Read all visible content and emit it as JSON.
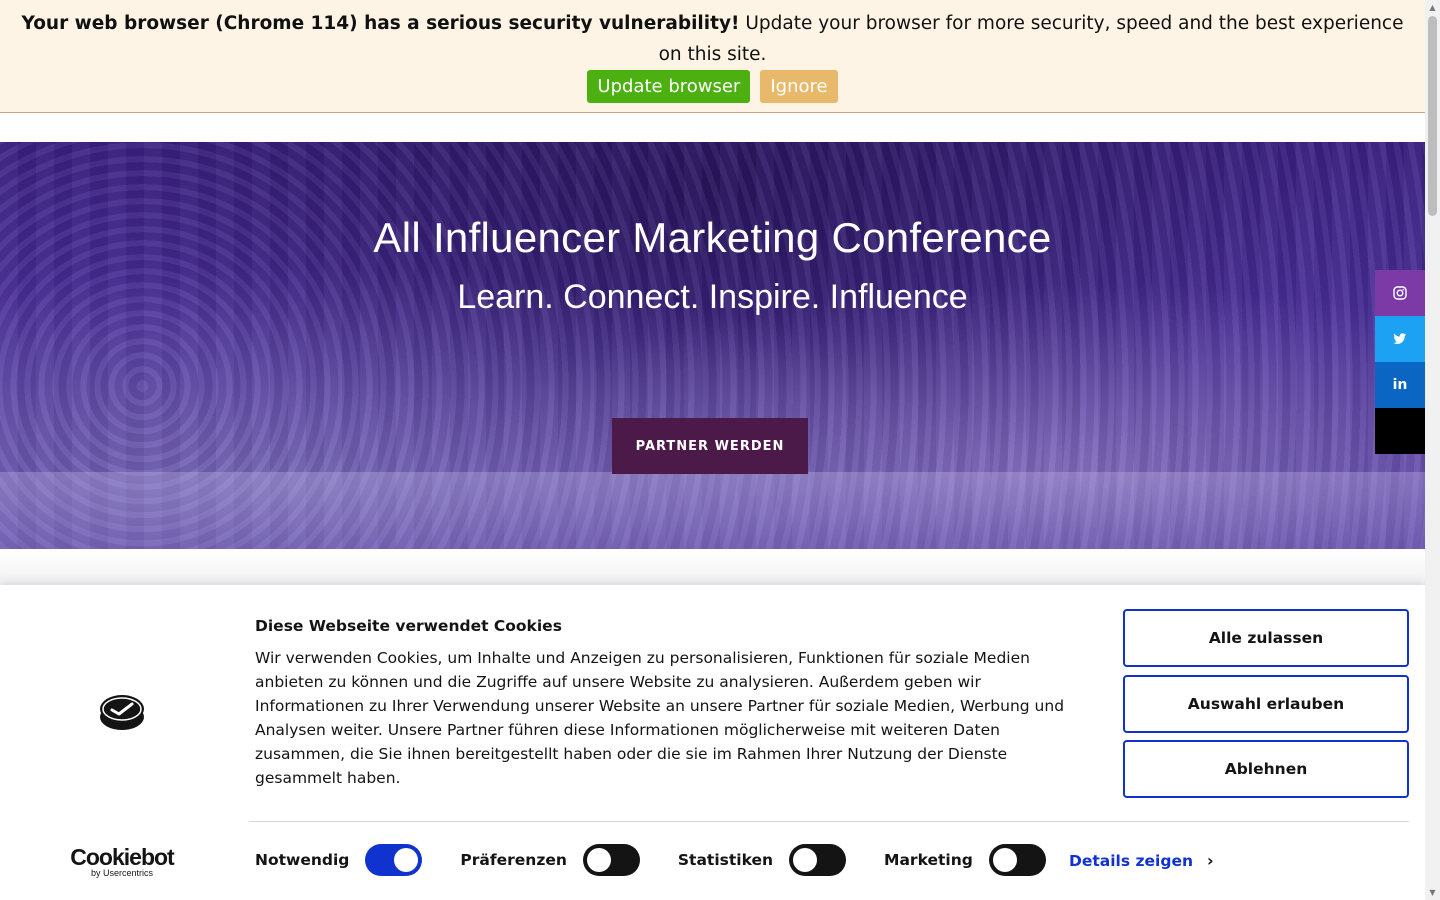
{
  "update_banner": {
    "warning": "Your web browser (Chrome 114) has a serious security vulnerability!",
    "message": " Update your browser for more security, speed and the best experience on this site.",
    "update_label": "Update browser",
    "ignore_label": "Ignore"
  },
  "hero": {
    "title": "All Influencer Marketing Conference",
    "subtitle": "Learn. Connect. Inspire. Influence",
    "cta_label": "PARTNER WERDEN"
  },
  "social": {
    "items": [
      {
        "icon": "instagram-icon",
        "glyph": "◎",
        "color": "#7c3aa6"
      },
      {
        "icon": "twitter-icon",
        "glyph": "🐦",
        "color": "#1da1f2"
      },
      {
        "icon": "linkedin-icon",
        "glyph": "in",
        "color": "#0a66c2"
      },
      {
        "icon": "x-icon",
        "glyph": "",
        "color": "#000000"
      }
    ]
  },
  "cookie": {
    "title": "Diese Webseite verwendet Cookies",
    "text": "Wir verwenden Cookies, um Inhalte und Anzeigen zu personalisieren, Funktionen für soziale Medien anbieten zu können und die Zugriffe auf unsere Website zu analysieren. Außerdem geben wir Informationen zu Ihrer Verwendung unserer Website an unsere Partner für soziale Medien, Werbung und Analysen weiter. Unsere Partner führen diese Informationen möglicherweise mit weiteren Daten zusammen, die Sie ihnen bereitgestellt haben oder die sie im Rahmen Ihrer Nutzung der Dienste gesammelt haben.",
    "buttons": {
      "allow_all": "Alle zulassen",
      "allow_selection": "Auswahl erlauben",
      "deny": "Ablehnen"
    },
    "brand": {
      "name": "Cookiebot",
      "by": "by Usercentrics"
    },
    "toggles": [
      {
        "label": "Notwendig",
        "on": true
      },
      {
        "label": "Präferenzen",
        "on": false
      },
      {
        "label": "Statistiken",
        "on": false
      },
      {
        "label": "Marketing",
        "on": false
      }
    ],
    "details_label": "Details zeigen",
    "accent_color": "#1032cf"
  }
}
